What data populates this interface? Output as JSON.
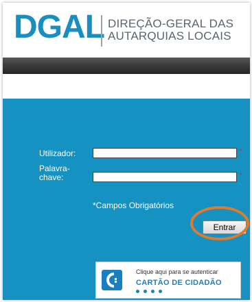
{
  "header": {
    "logo": "DGAL",
    "org_line1": "DIREÇÃO-GERAL DAS",
    "org_line2": "AUTARQUIAS LOCAIS"
  },
  "login": {
    "user_label": "Utilizador:",
    "user_value": "",
    "password_label_line1": "Palavra-",
    "password_label_line2": "chave:",
    "password_value": "",
    "required_marker": "*",
    "required_note": "*Campos Obrigatórios",
    "submit_label": "Entrar"
  },
  "citizen_card": {
    "hint": "Clique aqui para se autenticar",
    "title": "CARTÃO DE CIDADÃO"
  },
  "colors": {
    "brand_blue": "#1a8fbf",
    "panel_blue": "#1592c2",
    "highlight_orange": "#e07b2c"
  }
}
